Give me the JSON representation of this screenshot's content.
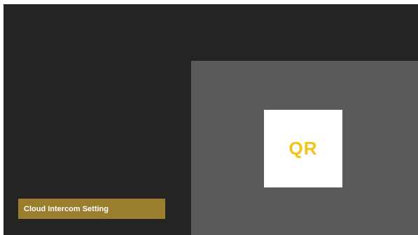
{
  "menu": {
    "items": [
      {
        "label": "Cloud Intercom Setting",
        "selected": true
      }
    ]
  },
  "preview": {
    "qr_placeholder": "QR"
  },
  "colors": {
    "background": "#252422",
    "panel": "#5b5a58",
    "selected_item": "#9b7d2e",
    "qr_text": "#f4c318",
    "qr_box": "#ffffff"
  }
}
